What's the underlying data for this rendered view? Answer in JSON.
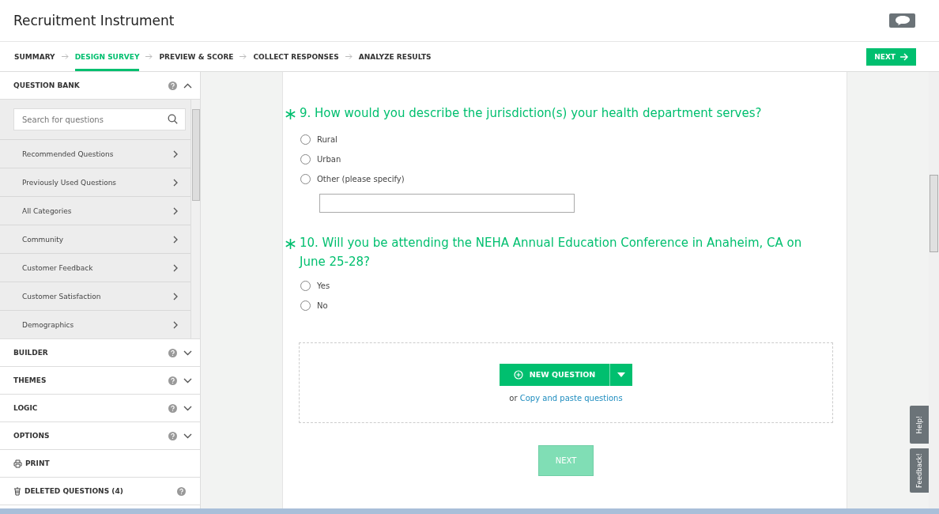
{
  "header": {
    "title": "Recruitment Instrument"
  },
  "steps": [
    {
      "label": "SUMMARY",
      "selected": false
    },
    {
      "label": "DESIGN SURVEY",
      "selected": true
    },
    {
      "label": "PREVIEW & SCORE",
      "selected": false
    },
    {
      "label": "COLLECT RESPONSES",
      "selected": false
    },
    {
      "label": "ANALYZE RESULTS",
      "selected": false
    }
  ],
  "next_button": "NEXT",
  "sidebar": {
    "panels": [
      {
        "kind": "section",
        "label": "QUESTION BANK",
        "expanded": true,
        "help": true
      },
      {
        "kind": "section",
        "label": "BUILDER",
        "expanded": false,
        "help": true
      },
      {
        "kind": "section",
        "label": "THEMES",
        "expanded": false,
        "help": true
      },
      {
        "kind": "section",
        "label": "LOGIC",
        "expanded": false,
        "help": true
      },
      {
        "kind": "section",
        "label": "OPTIONS",
        "expanded": false,
        "help": true
      },
      {
        "kind": "print",
        "label": "PRINT",
        "expanded": false,
        "help": false
      },
      {
        "kind": "trash",
        "label": "DELETED QUESTIONS (4)",
        "expanded": false,
        "help": true
      }
    ],
    "search": {
      "placeholder": "Search for questions"
    },
    "categories": [
      "Recommended Questions",
      "Previously Used Questions",
      "All Categories",
      "Community",
      "Customer Feedback",
      "Customer Satisfaction",
      "Demographics"
    ]
  },
  "questions": [
    {
      "required": true,
      "text": "9. How would you describe the jurisdiction(s) your health department serves?",
      "options": [
        {
          "kind": "choice",
          "label": "Rural",
          "selected": false
        },
        {
          "kind": "choice",
          "label": "Urban",
          "selected": false
        },
        {
          "kind": "other",
          "label": "Other (please specify)",
          "selected": false
        }
      ]
    },
    {
      "required": true,
      "text": "10. Will you be attending the NEHA Annual Education Conference in Anaheim, CA on June 25-28?",
      "options": [
        {
          "kind": "choice",
          "label": "Yes",
          "selected": false
        },
        {
          "kind": "choice",
          "label": "No",
          "selected": false
        }
      ]
    }
  ],
  "add_area": {
    "button": "NEW QUESTION",
    "or_text": "or",
    "link": "Copy and paste questions"
  },
  "page_next": "NEXT",
  "side_tabs": [
    "Help!",
    "Feedback!"
  ]
}
